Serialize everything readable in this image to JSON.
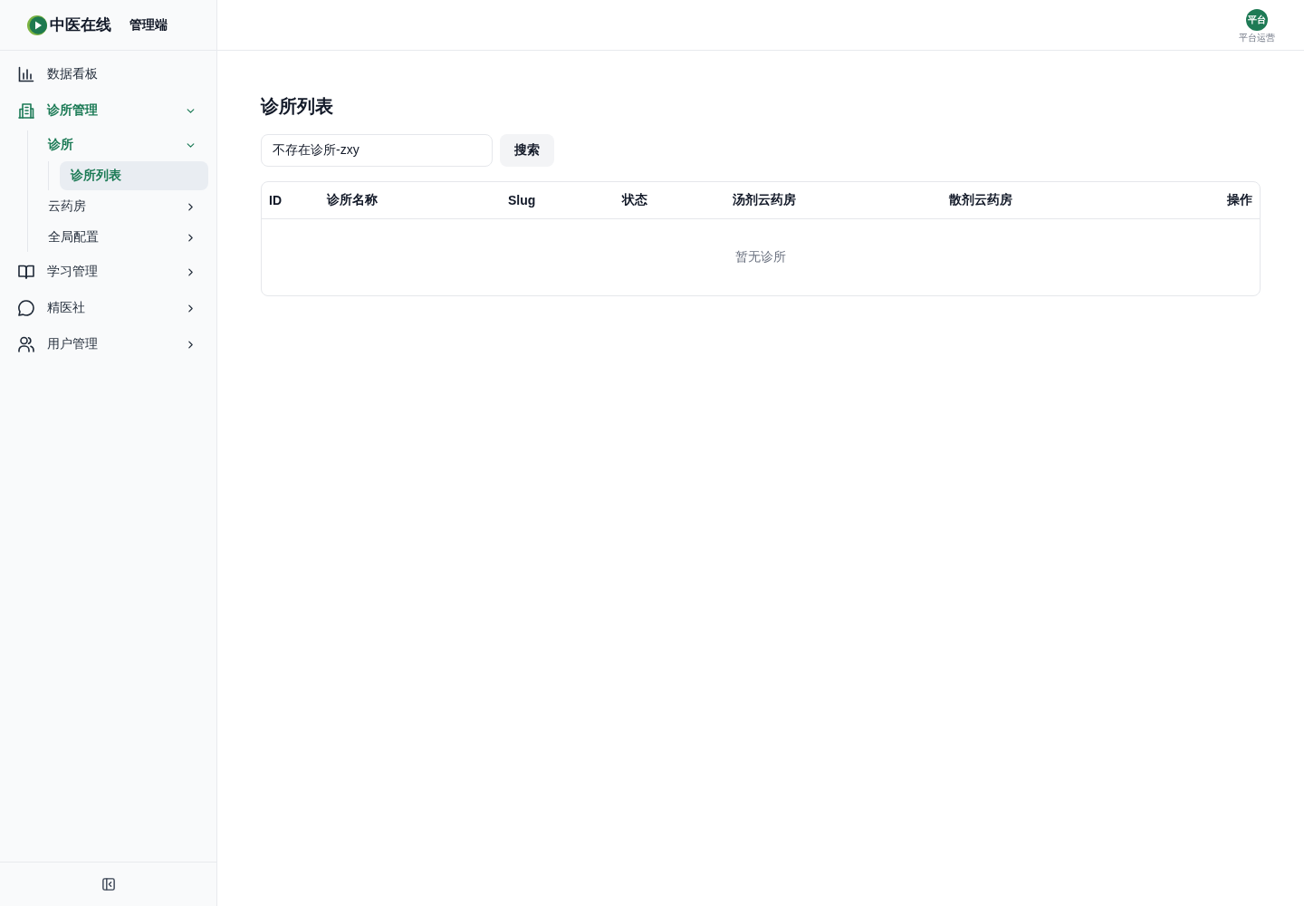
{
  "sidebar": {
    "brand": "中医在线",
    "app_label": "管理端",
    "nav": [
      {
        "label": "数据看板",
        "selected": false
      },
      {
        "label": "诊所管理",
        "selected": false,
        "expanded": true,
        "children": [
          {
            "label": "诊所",
            "selected": false,
            "expanded": true,
            "children": [
              {
                "label": "诊所列表",
                "selected": true
              }
            ]
          },
          {
            "label": "云药房",
            "selected": false,
            "expanded": false
          },
          {
            "label": "全局配置",
            "selected": false,
            "expanded": false
          }
        ]
      },
      {
        "label": "学习管理",
        "selected": false,
        "expanded": false
      },
      {
        "label": "精医社",
        "selected": false,
        "expanded": false
      },
      {
        "label": "用户管理",
        "selected": false,
        "expanded": false
      }
    ]
  },
  "header": {
    "user": {
      "avatar_text": "平台",
      "role": "平台运营"
    }
  },
  "page": {
    "title": "诊所列表",
    "search": {
      "value": "不存在诊所-zxy",
      "button": "搜索"
    },
    "table": {
      "columns": [
        "ID",
        "诊所名称",
        "Slug",
        "状态",
        "汤剂云药房",
        "散剂云药房",
        "操作"
      ],
      "empty_text": "暂无诊所"
    }
  }
}
